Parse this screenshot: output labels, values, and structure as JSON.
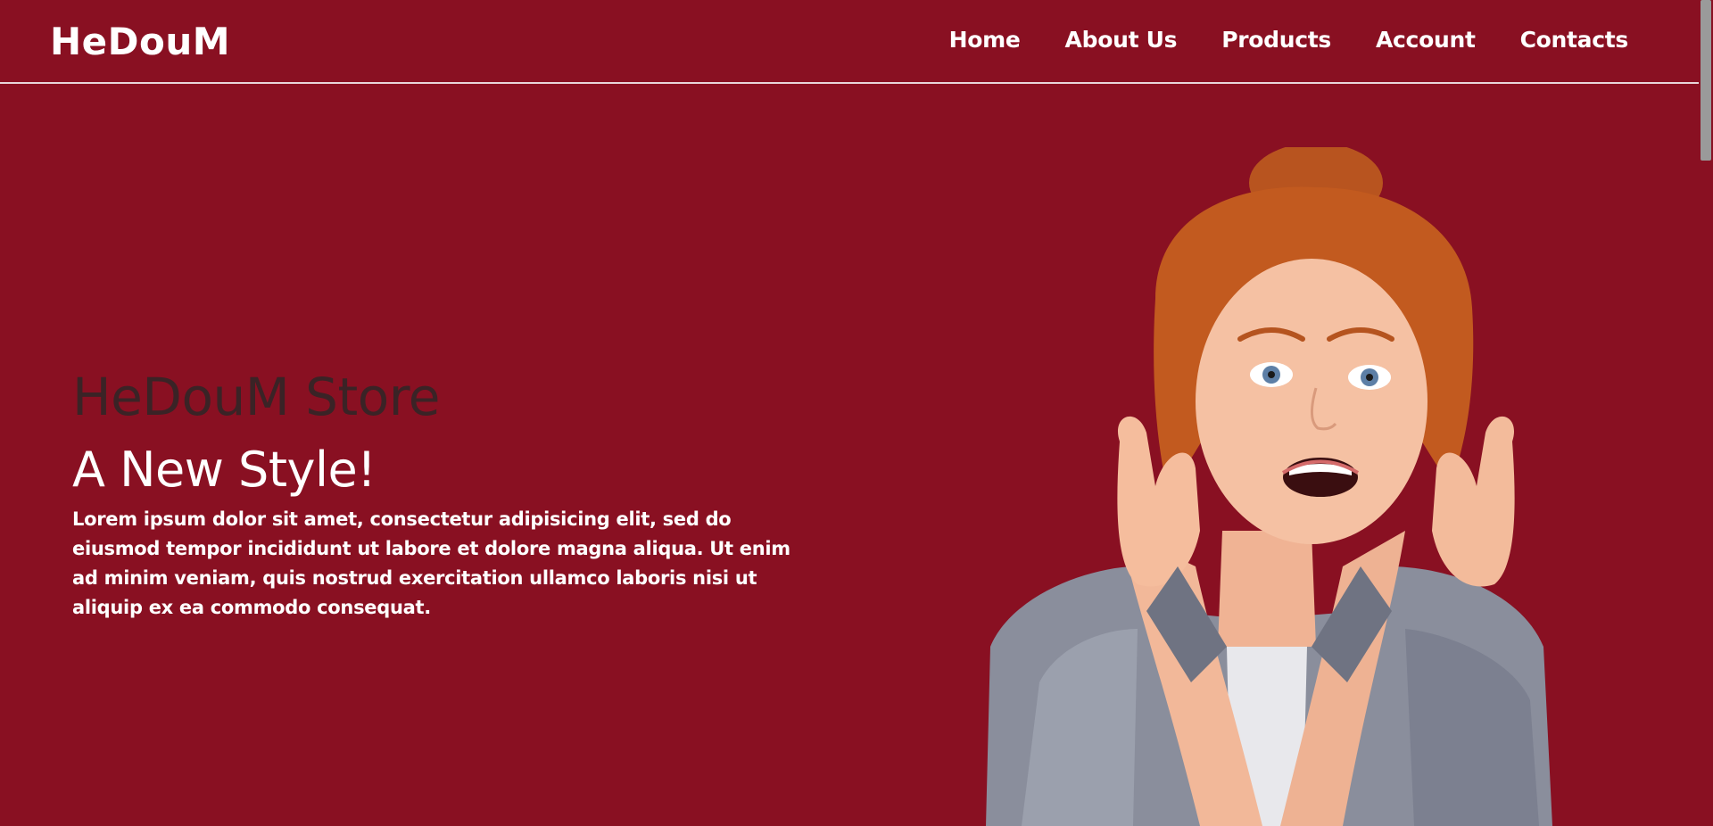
{
  "brand": {
    "logo": "HeDouM"
  },
  "nav": {
    "items": [
      {
        "label": "Home"
      },
      {
        "label": "About Us"
      },
      {
        "label": "Products"
      },
      {
        "label": "Account"
      },
      {
        "label": "Contacts"
      }
    ]
  },
  "hero": {
    "title": "HeDouM Store",
    "subtitle": "A New Style!",
    "text": "Lorem ipsum dolor sit amet, consectetur adipisicing elit, sed do eiusmod tempor incididunt ut labore et dolore magna aliqua. Ut enim ad minim veniam, quis nostrud exercitation ullamco laboris nisi ut aliquip ex ea commodo consequat."
  },
  "colors": {
    "background": "#891022",
    "title_text": "#3a2326",
    "text": "#ffffff"
  }
}
